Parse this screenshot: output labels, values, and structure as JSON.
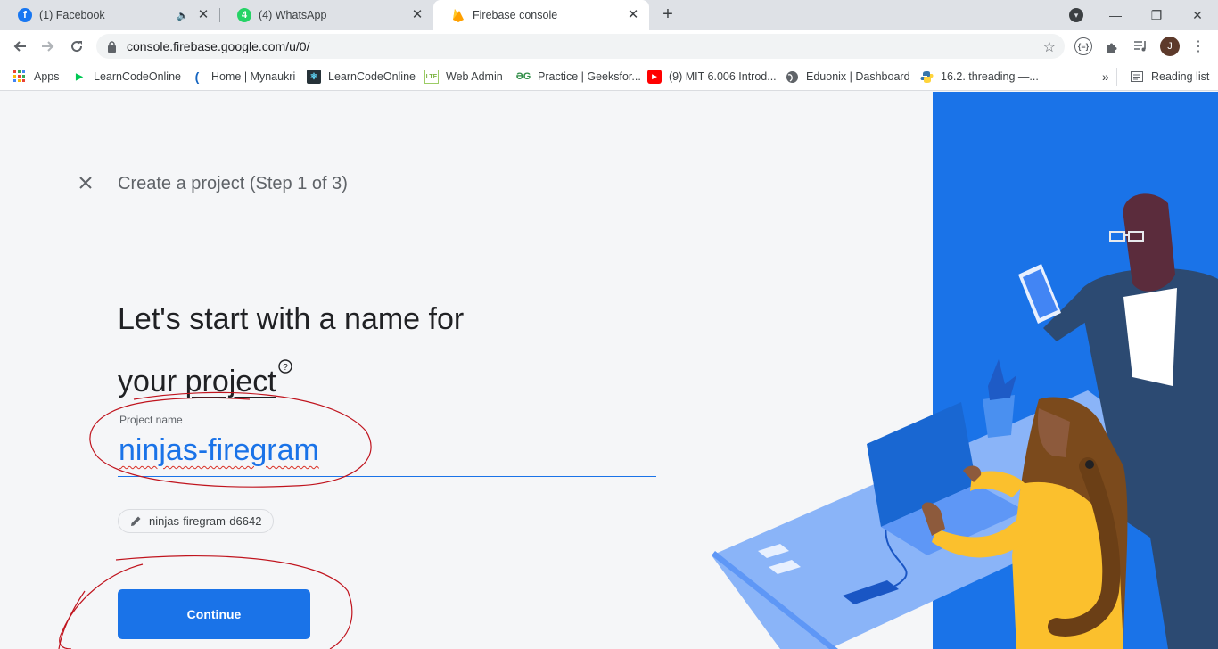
{
  "tabs": [
    {
      "title": "(1) Facebook",
      "icon": "facebook-icon",
      "color": "#1877f2"
    },
    {
      "title": "(4) WhatsApp",
      "icon": "whatsapp-icon",
      "color": "#25d366"
    },
    {
      "title": "Firebase console",
      "icon": "firebase-icon",
      "color": "#ffa000"
    }
  ],
  "window_controls": {
    "minimize": "—",
    "restore": "❐",
    "close": "✕"
  },
  "toolbar": {
    "url": "console.firebase.google.com/u/0/",
    "avatar_letter": "J"
  },
  "bookmarks": {
    "apps": "Apps",
    "items": [
      {
        "label": "LearnCodeOnline",
        "icon": "play-triangle-icon"
      },
      {
        "label": "Home | Mynaukri",
        "icon": "mynaukri-icon"
      },
      {
        "label": "LearnCodeOnline",
        "icon": "react-icon"
      },
      {
        "label": "Web Admin",
        "icon": "lte-icon"
      },
      {
        "label": "Practice | Geeksfor...",
        "icon": "geeksforgeeks-icon"
      },
      {
        "label": "(9) MIT 6.006 Introd...",
        "icon": "youtube-icon"
      },
      {
        "label": "Eduonix | Dashboard",
        "icon": "globe-icon"
      },
      {
        "label": "16.2. threading —...",
        "icon": "python-icon"
      }
    ],
    "overflow": "»",
    "reading_list": "Reading list"
  },
  "page": {
    "step_title": "Create a project (Step 1 of 3)",
    "headline_line1": "Let's start with a name for",
    "headline_your": "your ",
    "headline_project": "project",
    "help_glyph": "?",
    "field_label": "Project name",
    "field_value": "ninjas-firegram",
    "project_id": "ninjas-firegram-d6642",
    "continue_label": "Continue"
  },
  "colors": {
    "accent": "#1a73e8",
    "annotation": "#c0141e"
  }
}
